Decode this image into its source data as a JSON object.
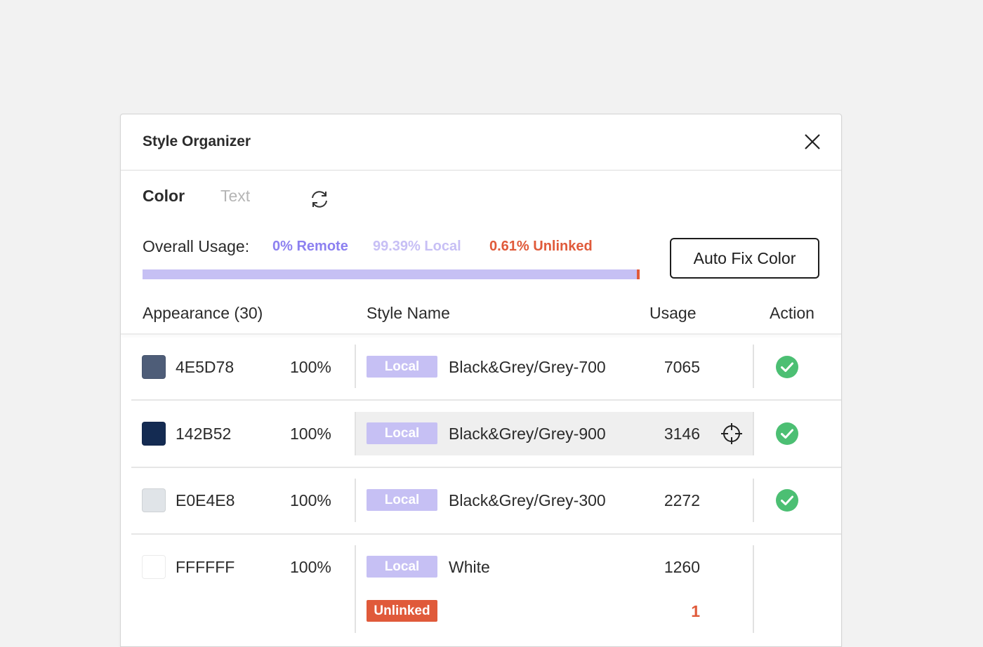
{
  "window": {
    "title": "Style Organizer"
  },
  "tabs": [
    {
      "label": "Color",
      "active": true
    },
    {
      "label": "Text",
      "active": false
    }
  ],
  "usage": {
    "label": "Overall Usage:",
    "remote": "0% Remote",
    "local": "99.39% Local",
    "unlinked": "0.61% Unlinked",
    "local_fraction": 0.9939,
    "unlinked_fraction": 0.0061
  },
  "autofix_label": "Auto Fix Color",
  "columns": {
    "appearance": "Appearance (30)",
    "style_name": "Style Name",
    "usage": "Usage",
    "action": "Action"
  },
  "colors": {
    "accent_local": "#c6c0f4",
    "accent_remote": "#8c80f0",
    "accent_unlinked": "#e05a3a",
    "check_green": "#4cbf73"
  },
  "rows": [
    {
      "hex": "4E5D78",
      "swatch": "#4E5D78",
      "opacity": "100%",
      "styles": [
        {
          "tag": "Local",
          "name": "Black&Grey/Grey-700",
          "usage": "7065"
        }
      ],
      "action": "check-circle-icon"
    },
    {
      "hex": "142B52",
      "swatch": "#142B52",
      "opacity": "100%",
      "styles": [
        {
          "tag": "Local",
          "name": "Black&Grey/Grey-900",
          "usage": "3146"
        }
      ],
      "action": "check-circle-icon",
      "hovered": true
    },
    {
      "hex": "E0E4E8",
      "swatch": "#E0E4E8",
      "opacity": "100%",
      "styles": [
        {
          "tag": "Local",
          "name": "Black&Grey/Grey-300",
          "usage": "2272"
        }
      ],
      "action": "check-circle-icon"
    },
    {
      "hex": "FFFFFF",
      "swatch": "#FFFFFF",
      "opacity": "100%",
      "styles": [
        {
          "tag": "Local",
          "name": "White",
          "usage": "1260"
        },
        {
          "tag": "Unlinked",
          "name": "",
          "usage": "1"
        }
      ],
      "action": ""
    }
  ]
}
